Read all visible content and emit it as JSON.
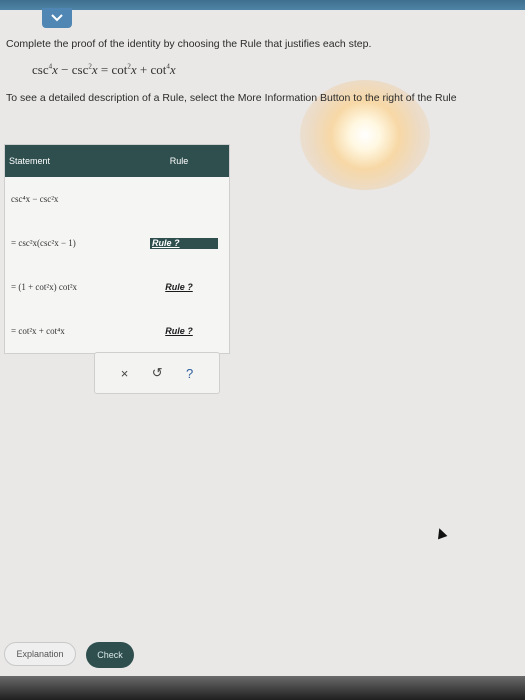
{
  "instructions": {
    "prompt": "Complete the proof of the identity by choosing the Rule that justifies each step.",
    "hint": "To see a detailed description of a Rule, select the More Information Button to the right of the Rule"
  },
  "identity": {
    "lhs_a": "csc",
    "p1": "4",
    "x1": "x",
    "minus": " − ",
    "lhs_b": "csc",
    "p2": "2",
    "x2": "x",
    "eq": " = ",
    "rhs_a": "cot",
    "p3": "2",
    "x3": "x",
    "plus": " + ",
    "rhs_b": "cot",
    "p4": "4",
    "x4": "x"
  },
  "table": {
    "header_statement": "Statement",
    "header_rule": "Rule",
    "rows": [
      {
        "statement": "csc⁴x  −  csc²x",
        "rule": ""
      },
      {
        "statement": "= csc²x(csc²x − 1)",
        "rule": "Rule ?"
      },
      {
        "statement": "= (1 + cot²x) cot²x",
        "rule": "Rule ?"
      },
      {
        "statement": "= cot²x + cot⁴x",
        "rule": "Rule ?"
      }
    ]
  },
  "actions": {
    "clear": "×",
    "undo": "↺",
    "help": "?"
  },
  "buttons": {
    "explanation": "Explanation",
    "check": "Check"
  },
  "icons": {
    "collapse": "chevron-down-icon",
    "clear": "close-icon",
    "undo": "undo-icon",
    "help": "help-icon"
  },
  "colors": {
    "header": "#2f4f4f",
    "topbar": "#4f84a6"
  }
}
